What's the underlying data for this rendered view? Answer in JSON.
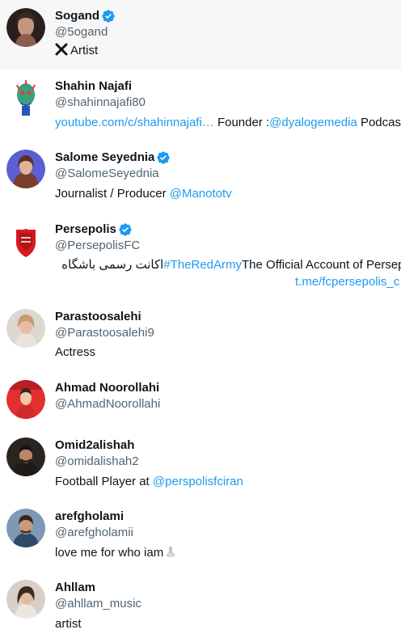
{
  "accounts": [
    {
      "name": "Sogand",
      "handle": "@5ogand",
      "verified": true,
      "bio_prefix_icon": "cross-mark-icon",
      "bio": "Artist",
      "avatar_colors": [
        "#b98a7c",
        "#3a2a26"
      ]
    },
    {
      "name": "Shahin Najafi",
      "handle": "@shahinnajafi80",
      "verified": false,
      "bio_link": "youtube.com/c/shahinnajafi…",
      "bio_middle": " Founder :",
      "bio_link2": "@dyalogemedia",
      "bio_end": " Podcast",
      "avatar_colors": [
        "#ffffff",
        "#3aa27a"
      ]
    },
    {
      "name": "Salome Seyednia",
      "handle": "@SalomeSeyednia",
      "verified": true,
      "bio_text": "Journalist / Producer ",
      "bio_link": "@Manototv",
      "avatar_colors": [
        "#6a6fd3",
        "#9b5b3d"
      ]
    },
    {
      "name": "Persepolis",
      "handle": "@PersepolisFC",
      "verified": true,
      "bio_rtl": "اکانت رسمی باشگاه ",
      "bio_link": "#TheRedArmy",
      "bio_end": "The Official Account of Persep",
      "bio_line2_link": "t.me/fcpersepolis_c",
      "avatar_colors": [
        "#ffffff",
        "#d71920"
      ]
    },
    {
      "name": "Parastoosalehi",
      "handle": "@Parastoosalehi9",
      "verified": false,
      "bio": "Actress",
      "avatar_colors": [
        "#d9d3cb",
        "#c7a07d"
      ]
    },
    {
      "name": "Ahmad Noorollahi",
      "handle": "@AhmadNoorollahi",
      "verified": false,
      "avatar_colors": [
        "#e1302f",
        "#f4d2b8"
      ]
    },
    {
      "name": "Omid2alishah",
      "handle": "@omidalishah2",
      "verified": false,
      "bio_text": "Football Player at ",
      "bio_link": "@perspolisfciran",
      "avatar_colors": [
        "#3b3430",
        "#1e1a18"
      ]
    },
    {
      "name": "arefgholami",
      "handle": "@arefgholamii",
      "verified": false,
      "bio": "love me for who iam",
      "bio_emoji": "folded-hands-icon",
      "avatar_colors": [
        "#7f99b4",
        "#5a3b2e"
      ]
    },
    {
      "name": "Ahllam",
      "handle": "@ahllam_music",
      "verified": false,
      "bio": "artist",
      "avatar_colors": [
        "#d8cfc9",
        "#3d2a22"
      ]
    }
  ],
  "accent": "#1d9bf0",
  "secondary_text": "#536471",
  "hover_bg": "#f7f7f7"
}
